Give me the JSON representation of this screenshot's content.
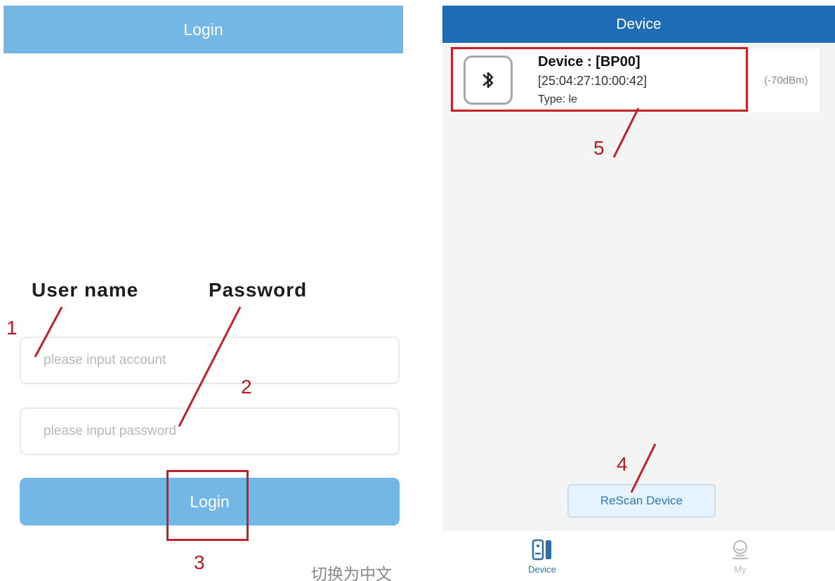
{
  "login": {
    "title": "Login",
    "account_placeholder": "please input account",
    "password_placeholder": "please input password",
    "login_button": "Login",
    "language_toggle": "切换为中文"
  },
  "device": {
    "title": "Device",
    "item": {
      "name": "Device : [BP00]",
      "mac": "[25:04:27:10:00:42]",
      "type": "Type: le",
      "rssi": "(-70dBm)",
      "icon": "bluetooth-icon"
    },
    "rescan_button": "ReScan Device",
    "nav": {
      "device": "Device",
      "my": "My"
    }
  },
  "annotations": {
    "user_name": "User name",
    "password": "Password",
    "markers": [
      "1",
      "2",
      "3",
      "4",
      "5"
    ]
  },
  "colors": {
    "login_blue": "#72b7e5",
    "device_blue": "#1f6db5",
    "annotation_red": "#c32027"
  }
}
